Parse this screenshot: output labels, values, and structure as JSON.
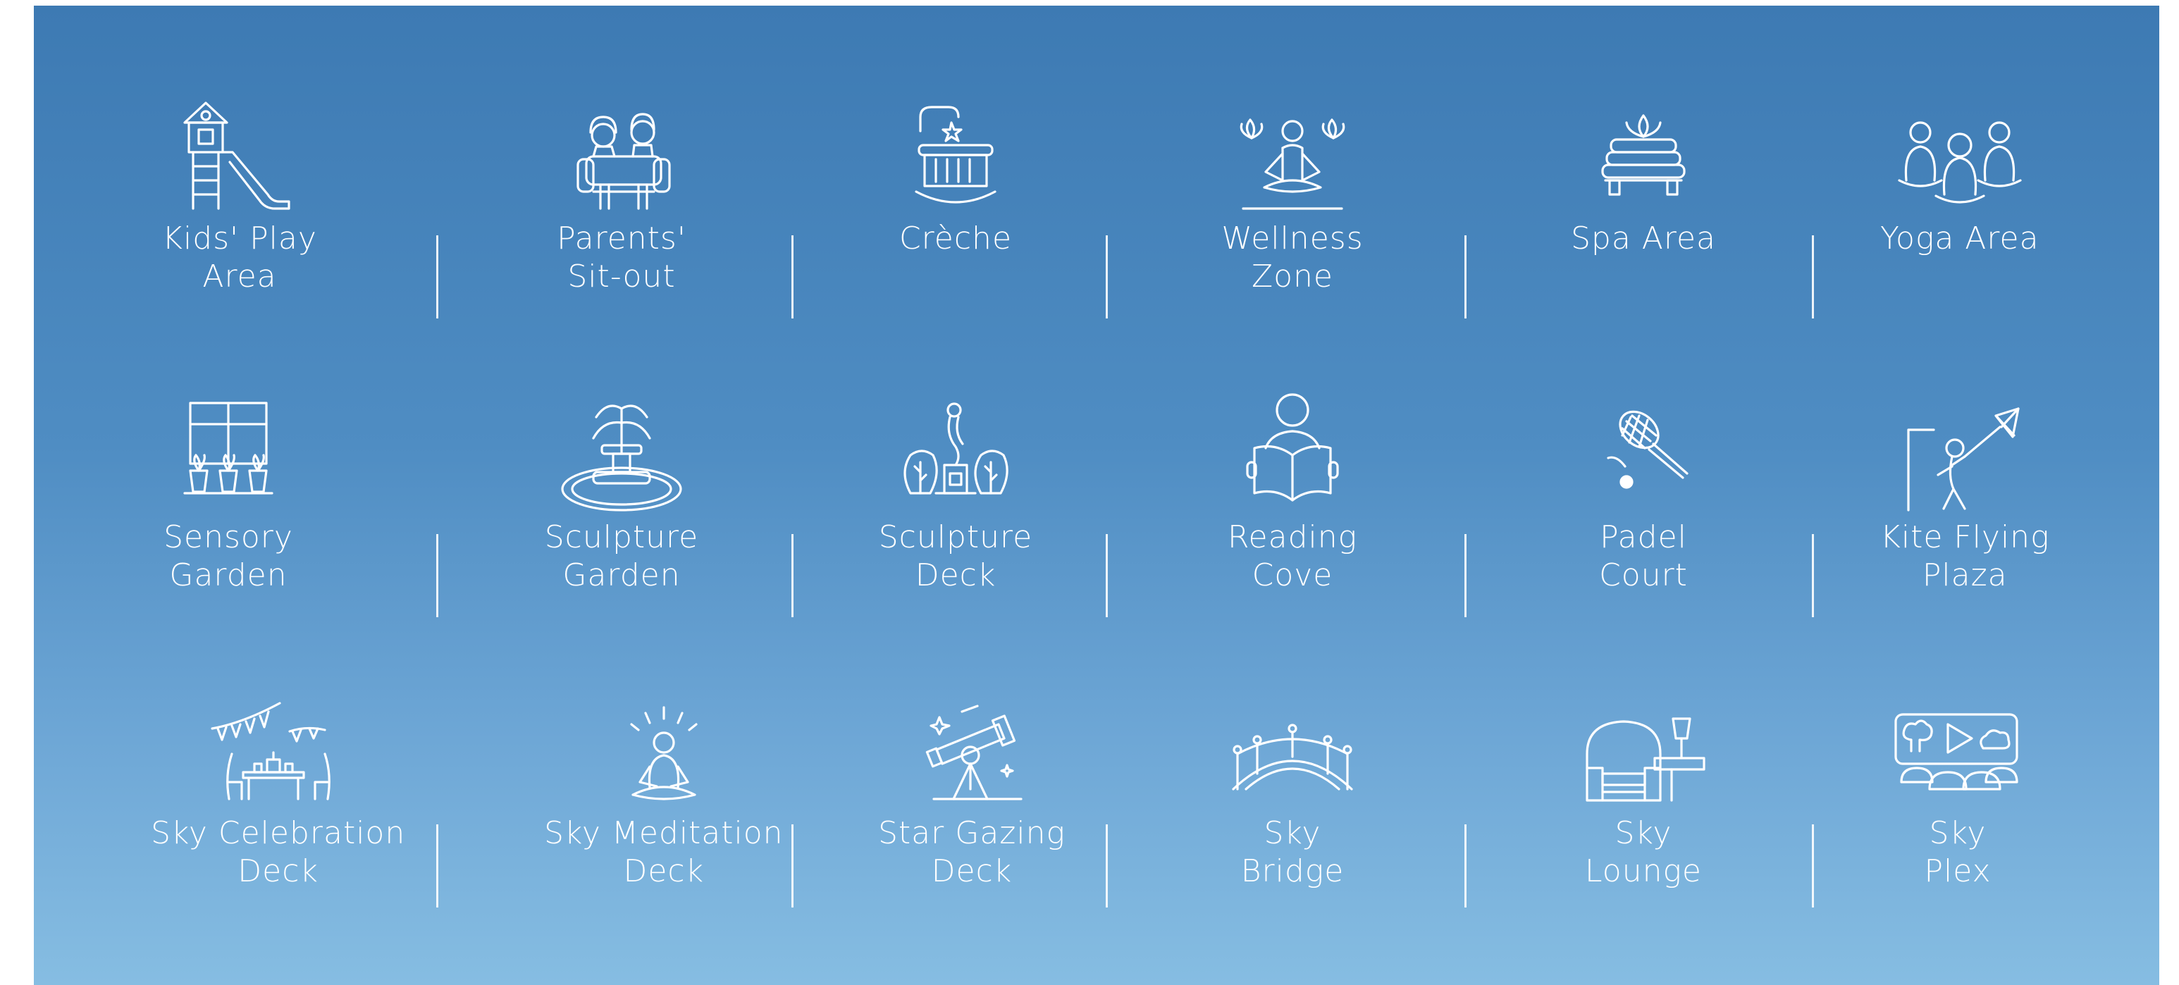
{
  "rows": [
    [
      {
        "label": "Kids' Play\nArea",
        "icon": "playground-slide-icon"
      },
      {
        "label": "Parents'\nSit-out",
        "icon": "couple-on-sofa-icon"
      },
      {
        "label": "Crèche",
        "icon": "cradle-icon"
      },
      {
        "label": "Wellness\nZone",
        "icon": "meditation-lotus-icon"
      },
      {
        "label": "Spa Area",
        "icon": "towels-lotus-icon"
      },
      {
        "label": "Yoga Area",
        "icon": "group-yoga-icon"
      }
    ],
    [
      {
        "label": "Sensory\nGarden",
        "icon": "window-planters-icon"
      },
      {
        "label": "Sculpture\nGarden",
        "icon": "fountain-icon"
      },
      {
        "label": "Sculpture\nDeck",
        "icon": "sculpture-trees-icon"
      },
      {
        "label": "Reading\nCove",
        "icon": "person-reading-icon"
      },
      {
        "label": "Padel\nCourt",
        "icon": "racket-ball-icon"
      },
      {
        "label": "Kite Flying\nPlaza",
        "icon": "kite-flyer-icon"
      }
    ],
    [
      {
        "label": "Sky Celebration\nDeck",
        "icon": "party-table-bunting-icon"
      },
      {
        "label": "Sky Meditation\nDeck",
        "icon": "meditating-person-icon"
      },
      {
        "label": "Star Gazing\nDeck",
        "icon": "telescope-icon"
      },
      {
        "label": "Sky\nBridge",
        "icon": "arched-bridge-icon"
      },
      {
        "label": "Sky\nLounge",
        "icon": "armchair-table-icon"
      },
      {
        "label": "Sky\nPlex",
        "icon": "outdoor-cinema-icon"
      }
    ]
  ],
  "colors": {
    "background_top": "#3d7ab3",
    "background_bottom": "#86bde2",
    "foreground": "#ffffff"
  }
}
